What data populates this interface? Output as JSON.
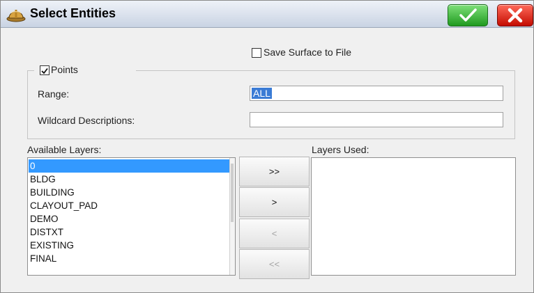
{
  "dialog": {
    "title": "Select Entities",
    "icon": "hard-hat-icon",
    "ok_icon": "checkmark-icon",
    "cancel_icon": "close-x-icon",
    "colors": {
      "ok": "#2aa52a",
      "cancel": "#e0180c",
      "selection": "#3399ff"
    }
  },
  "save_surface": {
    "label": "Save Surface to File",
    "checked": false
  },
  "points": {
    "label": "Points",
    "checked": true,
    "range": {
      "label": "Range:",
      "value": "ALL"
    },
    "wildcard": {
      "label": "Wildcard Descriptions:",
      "value": ""
    }
  },
  "available_layers": {
    "label": "Available Layers:",
    "items": [
      "0",
      "BLDG",
      "BUILDING",
      "CLAYOUT_PAD",
      "DEMO",
      "DISTXT",
      "EXISTING",
      "FINAL"
    ],
    "selected_index": 0
  },
  "layers_used": {
    "label": "Layers Used:",
    "items": []
  },
  "transfer_buttons": {
    "add_all": ">>",
    "add": ">",
    "remove": "<",
    "remove_all": "<<"
  }
}
